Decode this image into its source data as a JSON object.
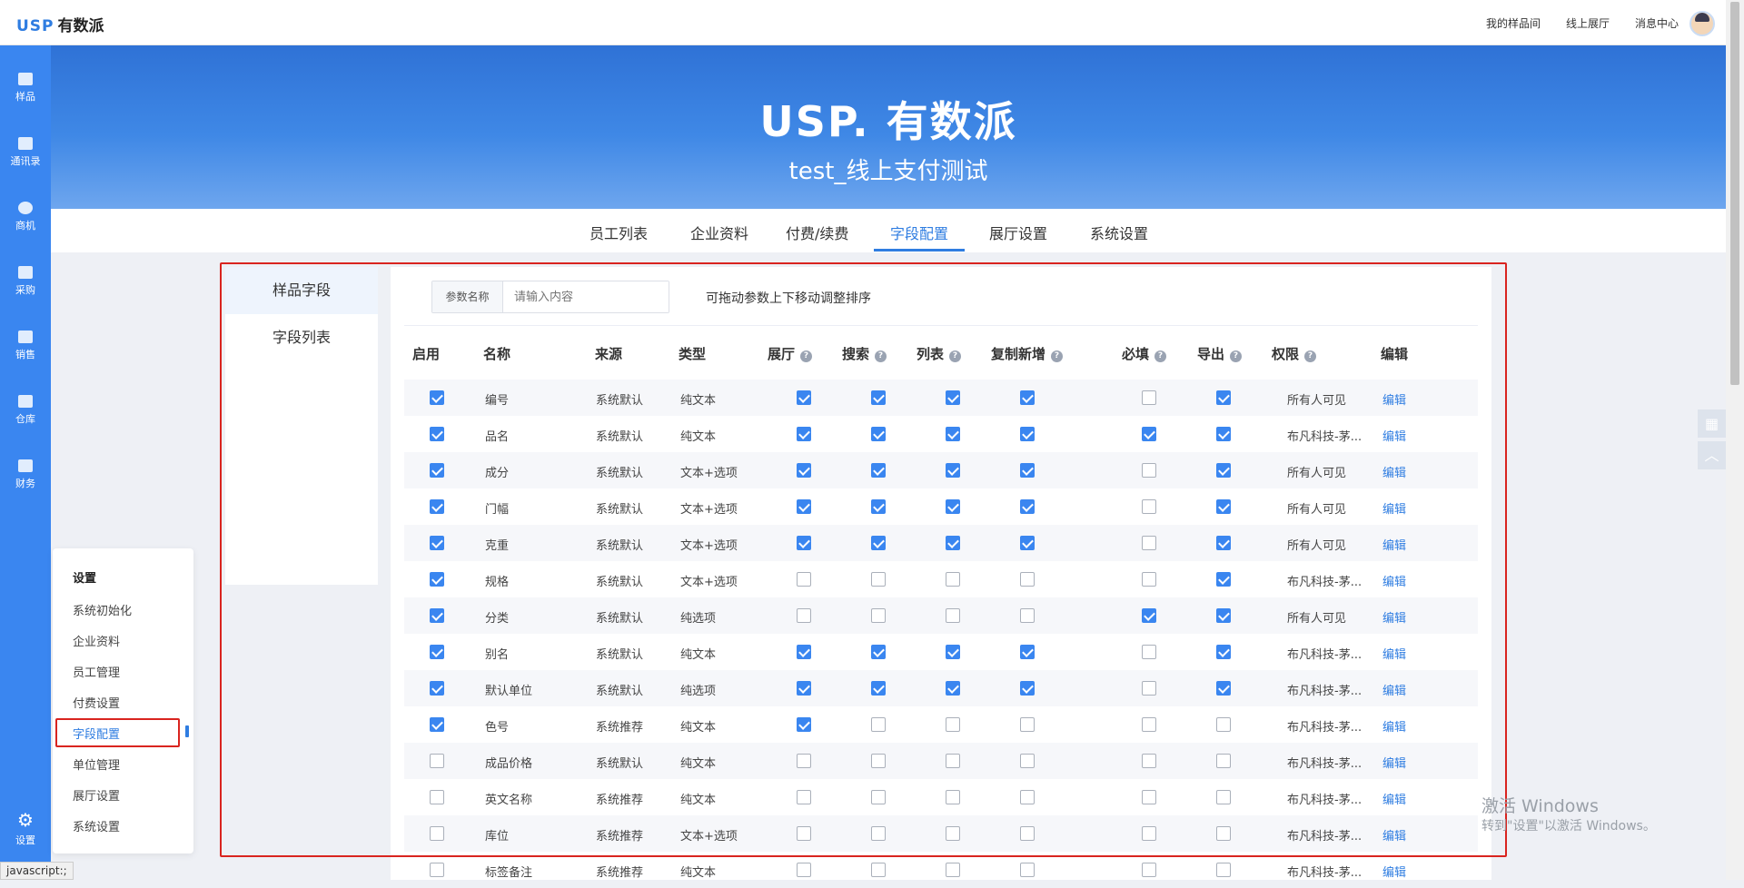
{
  "app": {
    "logo_mark": "USP",
    "logo_text": "有数派"
  },
  "header": {
    "links": [
      "我的样品间",
      "线上展厅",
      "消息中心"
    ]
  },
  "sidebar": {
    "items": [
      {
        "label": "样品",
        "icon": "sample-icon"
      },
      {
        "label": "通讯录",
        "icon": "contacts-icon"
      },
      {
        "label": "商机",
        "icon": "opportunity-icon"
      },
      {
        "label": "采购",
        "icon": "purchase-icon"
      },
      {
        "label": "销售",
        "icon": "sales-icon"
      },
      {
        "label": "仓库",
        "icon": "warehouse-icon"
      },
      {
        "label": "财务",
        "icon": "finance-icon"
      }
    ],
    "settings_label": "设置"
  },
  "banner": {
    "logo": "USP. 有数派",
    "company": "test_线上支付测试"
  },
  "tabs": {
    "items": [
      "员工列表",
      "企业资料",
      "付费/续费",
      "字段配置",
      "展厅设置",
      "系统设置"
    ],
    "active": "字段配置"
  },
  "settings_menu": {
    "title": "设置",
    "items": [
      "系统初始化",
      "企业资料",
      "员工管理",
      "付费设置",
      "字段配置",
      "单位管理",
      "展厅设置",
      "系统设置"
    ],
    "active": "字段配置"
  },
  "field_nav": {
    "items": [
      "样品字段",
      "字段列表"
    ],
    "active": "样品字段"
  },
  "search": {
    "label": "参数名称",
    "placeholder": "请输入内容",
    "hint": "可拖动参数上下移动调整排序"
  },
  "table": {
    "headers": {
      "enabled": "启用",
      "name": "名称",
      "source": "来源",
      "type": "类型",
      "hall": "展厅",
      "search": "搜索",
      "list": "列表",
      "copy_new": "复制新增",
      "required": "必填",
      "export": "导出",
      "permission": "权限",
      "edit": "编辑"
    },
    "rows": [
      {
        "enabled": true,
        "name": "编号",
        "source": "系统默认",
        "type": "纯文本",
        "hall": true,
        "search": true,
        "list": true,
        "copy_new": true,
        "required": false,
        "export": true,
        "permission": "所有人可见",
        "edit": "编辑"
      },
      {
        "enabled": true,
        "name": "品名",
        "source": "系统默认",
        "type": "纯文本",
        "hall": true,
        "search": true,
        "list": true,
        "copy_new": true,
        "required": true,
        "export": true,
        "permission": "布凡科技-茅...",
        "edit": "编辑"
      },
      {
        "enabled": true,
        "name": "成分",
        "source": "系统默认",
        "type": "文本+选项",
        "hall": true,
        "search": true,
        "list": true,
        "copy_new": true,
        "required": false,
        "export": true,
        "permission": "所有人可见",
        "edit": "编辑"
      },
      {
        "enabled": true,
        "name": "门幅",
        "source": "系统默认",
        "type": "文本+选项",
        "hall": true,
        "search": true,
        "list": true,
        "copy_new": true,
        "required": false,
        "export": true,
        "permission": "所有人可见",
        "edit": "编辑"
      },
      {
        "enabled": true,
        "name": "克重",
        "source": "系统默认",
        "type": "文本+选项",
        "hall": true,
        "search": true,
        "list": true,
        "copy_new": true,
        "required": false,
        "export": true,
        "permission": "所有人可见",
        "edit": "编辑"
      },
      {
        "enabled": true,
        "name": "规格",
        "source": "系统默认",
        "type": "文本+选项",
        "hall": false,
        "search": false,
        "list": false,
        "copy_new": false,
        "required": false,
        "export": true,
        "permission": "布凡科技-茅...",
        "edit": "编辑"
      },
      {
        "enabled": true,
        "name": "分类",
        "source": "系统默认",
        "type": "纯选项",
        "hall": false,
        "search": false,
        "list": false,
        "copy_new": false,
        "required": true,
        "export": true,
        "permission": "所有人可见",
        "edit": "编辑"
      },
      {
        "enabled": true,
        "name": "别名",
        "source": "系统默认",
        "type": "纯文本",
        "hall": true,
        "search": true,
        "list": true,
        "copy_new": true,
        "required": false,
        "export": true,
        "permission": "布凡科技-茅...",
        "edit": "编辑"
      },
      {
        "enabled": true,
        "name": "默认单位",
        "source": "系统默认",
        "type": "纯选项",
        "hall": true,
        "search": true,
        "list": true,
        "copy_new": true,
        "required": false,
        "export": true,
        "permission": "布凡科技-茅...",
        "edit": "编辑"
      },
      {
        "enabled": true,
        "name": "色号",
        "source": "系统推荐",
        "type": "纯文本",
        "hall": true,
        "search": false,
        "list": false,
        "copy_new": false,
        "required": false,
        "export": false,
        "permission": "布凡科技-茅...",
        "edit": "编辑"
      },
      {
        "enabled": false,
        "name": "成品价格",
        "source": "系统默认",
        "type": "纯文本",
        "hall": false,
        "search": false,
        "list": false,
        "copy_new": false,
        "required": false,
        "export": false,
        "permission": "布凡科技-茅...",
        "edit": "编辑"
      },
      {
        "enabled": false,
        "name": "英文名称",
        "source": "系统推荐",
        "type": "纯文本",
        "hall": false,
        "search": false,
        "list": false,
        "copy_new": false,
        "required": false,
        "export": false,
        "permission": "布凡科技-茅...",
        "edit": "编辑"
      },
      {
        "enabled": false,
        "name": "库位",
        "source": "系统推荐",
        "type": "文本+选项",
        "hall": false,
        "search": false,
        "list": false,
        "copy_new": false,
        "required": false,
        "export": false,
        "permission": "布凡科技-茅...",
        "edit": "编辑"
      },
      {
        "enabled": false,
        "name": "标签备注",
        "source": "系统推荐",
        "type": "纯文本",
        "hall": false,
        "search": false,
        "list": false,
        "copy_new": false,
        "required": false,
        "export": false,
        "permission": "布凡科技-茅...",
        "edit": "编辑"
      }
    ]
  },
  "watermark": {
    "line1": "激活 Windows",
    "line2": "转到\"设置\"以激活 Windows。"
  },
  "status_bar": "javascript:;",
  "colors": {
    "accent": "#3a86f0",
    "highlight_border": "#d9241f"
  }
}
